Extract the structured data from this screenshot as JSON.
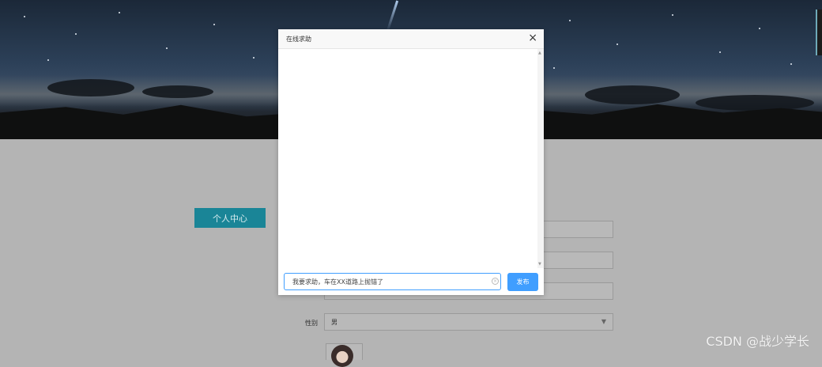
{
  "modal": {
    "title": "在线求助",
    "close_symbol": "×",
    "input_value": "我要求助，车在XX道路上抛锚了",
    "send_label": "发布",
    "clear_symbol": "×"
  },
  "page": {
    "profile_button_label": "个人中心",
    "gender_label": "性别",
    "gender_value": "男"
  },
  "watermark": "CSDN @战少学长",
  "icons": {
    "close": "close-icon",
    "clear": "clear-icon",
    "chevron": "chevron-down-icon"
  },
  "colors": {
    "primary": "#409eff",
    "profile_button": "#1a8597"
  }
}
